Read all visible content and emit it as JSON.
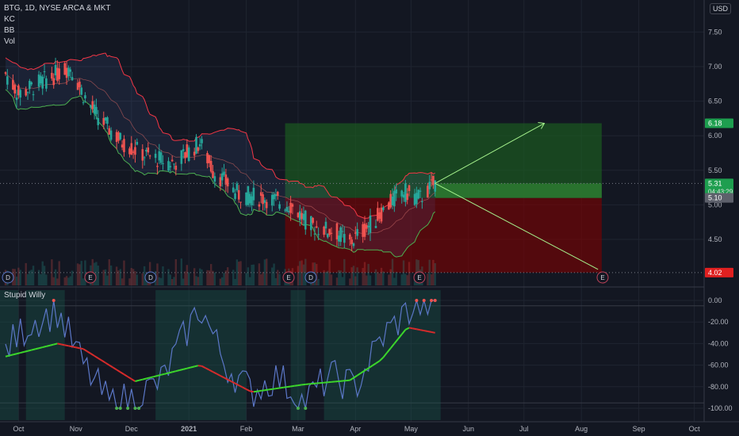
{
  "header": {
    "symbol_line": "BTG, 1D, NYSE ARCA & MKT",
    "indicators": [
      "KC",
      "BB",
      "Vol"
    ],
    "currency": "USD"
  },
  "sub_panel": {
    "title": "Stupid Willy"
  },
  "colors": {
    "background": "#131722",
    "candle_up": "#26a69a",
    "candle_down": "#ef5350",
    "upper_band": "#f23645",
    "lower_band": "#4caf50",
    "profit_zone": "#1b5e20",
    "loss_zone": "#7f0000",
    "projection": "#a5f28d",
    "oscillator": "#5b77c7"
  },
  "chart_data": [
    {
      "type": "candlestick",
      "price_axis": {
        "ticks": [
          "7.50",
          "7.00",
          "6.50",
          "6.00",
          "5.50",
          "5.00",
          "4.50"
        ],
        "ylim": [
          4.0,
          7.8
        ]
      },
      "time_axis": {
        "ticks": [
          "Oct",
          "Nov",
          "Dec",
          "2021",
          "Feb",
          "Mar",
          "Apr",
          "May",
          "Jun",
          "Jul",
          "Aug",
          "Sep",
          "Oct"
        ]
      },
      "price_labels": [
        {
          "text": "6.18",
          "value": 6.18,
          "color": "#1e9e4f"
        },
        {
          "text": "5.31",
          "value": 5.31,
          "color": "#1e9e4f",
          "countdown": "04:43:29"
        },
        {
          "text": "5.10",
          "value": 5.1,
          "color": "#5d606b"
        },
        {
          "text": "4.02",
          "value": 4.02,
          "color": "#e02020"
        }
      ],
      "position": {
        "entry": 5.1,
        "target": 6.18,
        "stop": 4.02,
        "start": "2021-02-22",
        "end": "2021-08-12"
      },
      "approx_closes": {
        "x": [
          "2020-09-24",
          "2020-10-01",
          "2020-10-15",
          "2020-10-29",
          "2020-11-05",
          "2020-11-12",
          "2020-11-26",
          "2020-12-10",
          "2020-12-24",
          "2021-01-07",
          "2021-01-14",
          "2021-01-28",
          "2021-02-11",
          "2021-02-25",
          "2021-03-08",
          "2021-03-22",
          "2021-03-29",
          "2021-04-12",
          "2021-04-26",
          "2021-05-06",
          "2021-05-14"
        ],
        "values": [
          6.9,
          6.6,
          6.8,
          7.0,
          6.6,
          6.3,
          5.9,
          5.7,
          5.6,
          5.9,
          5.5,
          5.15,
          5.1,
          5.0,
          4.7,
          4.6,
          4.45,
          4.8,
          5.2,
          5.1,
          5.31
        ]
      },
      "event_markers": [
        "D",
        "E",
        "D",
        "E",
        "D",
        "E",
        "E"
      ]
    },
    {
      "type": "line",
      "name": "Stupid Willy",
      "y_axis": {
        "ticks": [
          "0.00",
          "-20.00",
          "-40.00",
          "-60.00",
          "-80.00",
          "-100.00"
        ],
        "ylim": [
          -105,
          5
        ]
      },
      "lines": [
        {
          "role": "oscillator",
          "x": [
            "2020-09-24",
            "2020-10-08",
            "2020-10-22",
            "2020-11-05",
            "2020-11-19",
            "2020-12-03",
            "2020-12-17",
            "2021-01-07",
            "2021-01-21",
            "2021-02-04",
            "2021-02-18",
            "2021-03-04",
            "2021-03-18",
            "2021-04-01",
            "2021-04-15",
            "2021-04-29",
            "2021-05-14"
          ],
          "values": [
            -45,
            -20,
            -10,
            -60,
            -95,
            -90,
            -75,
            -5,
            -60,
            -85,
            -70,
            -95,
            -70,
            -80,
            -35,
            -10,
            0
          ]
        },
        {
          "role": "signal",
          "x": [
            "2020-09-24",
            "2020-10-22",
            "2020-11-05",
            "2020-12-03",
            "2021-01-07",
            "2021-02-04",
            "2021-03-04",
            "2021-03-29",
            "2021-04-15",
            "2021-04-29",
            "2021-05-14"
          ],
          "values": [
            -52,
            -40,
            -45,
            -75,
            -60,
            -85,
            -78,
            -74,
            -55,
            -25,
            -30
          ]
        }
      ]
    }
  ]
}
